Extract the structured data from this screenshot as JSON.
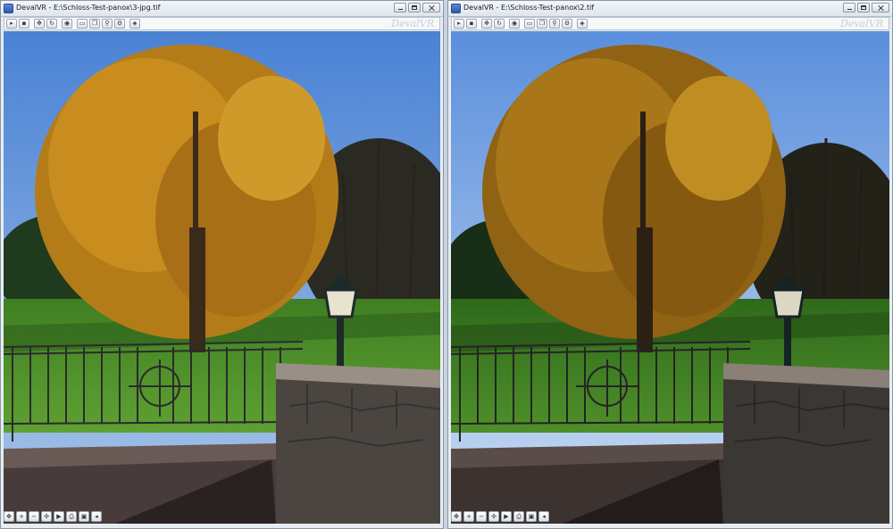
{
  "windows": [
    {
      "title": "DevalVR - E:\\Schloss-Test-panox\\3-jpg.tif"
    },
    {
      "title": "DevalVR - E:\\Schloss-Test-panox\\2.tif"
    }
  ],
  "brand": "DevalVR",
  "toolbar_icons": [
    "open-icon",
    "save-icon",
    "autopan-icon",
    "rotate-icon",
    "globe-icon",
    "frame-icon",
    "copy-icon",
    "zoom-icon",
    "settings-icon",
    "cube-icon"
  ],
  "bottom_icons": [
    "navigate-icon",
    "zoom-in-icon",
    "zoom-out-icon",
    "center-icon",
    "play-icon",
    "print-icon",
    "fullscreen-icon",
    "sound-icon"
  ],
  "colors": {
    "sky": "#5f8fd0",
    "foliage": "#c88a1c",
    "grass": "#4f8f2c",
    "stone": "#4a4541"
  }
}
